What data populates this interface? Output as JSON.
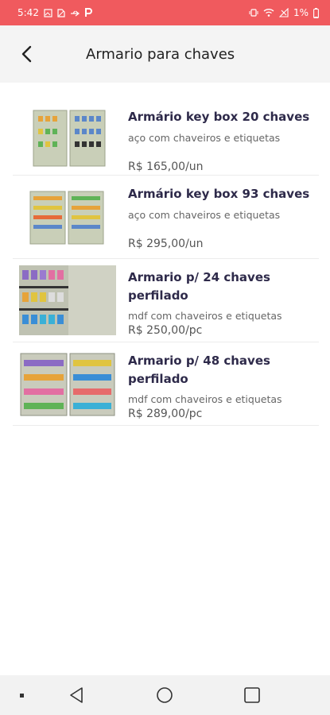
{
  "status_bar": {
    "time": "5:42",
    "battery": "1%",
    "left_icons": [
      "gallery-icon",
      "sim-icon",
      "usb-icon",
      "p-icon"
    ],
    "right_icons": [
      "vibrate-icon",
      "wifi-icon",
      "no-signal-icon",
      "battery-icon"
    ]
  },
  "app_bar": {
    "title": "Armario para chaves",
    "back_icon": "chevron-left-icon"
  },
  "products": [
    {
      "name": "Armário key box 20 chaves",
      "description": "aço com chaveiros e etiquetas",
      "price": "R$ 165,00/un"
    },
    {
      "name": "Armário key box 93 chaves",
      "description": "aço com chaveiros e etiquetas",
      "price": "R$ 295,00/un"
    },
    {
      "name": "Armario p/ 24 chaves perfilado",
      "description": "mdf com chaveiros e etiquetas",
      "price": "R$ 250,00/pc"
    },
    {
      "name": "Armario p/ 48 chaves perfilado",
      "description": "mdf com chaveiros e etiquetas",
      "price": "R$ 289,00/pc"
    }
  ],
  "nav_bar": {
    "icons": [
      "dot-icon",
      "back-triangle-icon",
      "home-circle-icon",
      "recents-square-icon"
    ]
  },
  "colors": {
    "status_bar": "#f05a5e",
    "product_title": "#2e2a4a",
    "app_bar": "#f4f4f4"
  }
}
